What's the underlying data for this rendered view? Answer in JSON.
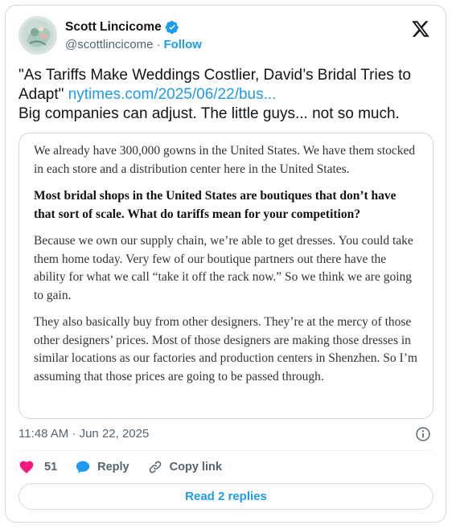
{
  "author": {
    "name": "Scott Lincicome",
    "handle": "@scottlincicome",
    "separator": "·",
    "follow_label": "Follow"
  },
  "tweet": {
    "text_line1_prefix": "\"As Tariffs Make Weddings Costlier, David’s Bridal Tries to Adapt\"",
    "link": "nytimes.com/2025/06/22/bus...",
    "text_line2": "Big companies can adjust. The little guys... not so much."
  },
  "quoted_image": {
    "paragraphs": [
      {
        "text": "We already have 300,000 gowns in the United States. We have them stocked in each store and a distribution center here in the United States.",
        "bold": false
      },
      {
        "text": "Most bridal shops in the United States are boutiques that don’t have that sort of scale. What do tariffs mean for your competition?",
        "bold": true
      },
      {
        "text": "Because we own our supply chain, we’re able to get dresses. You could take them home today. Very few of our boutique partners out there have the ability for what we call “take it off the rack now.” So we think we are going to gain.",
        "bold": false
      },
      {
        "text": "They also basically buy from other designers. They’re at the mercy of those other designers’ prices. Most of those designers are making those dresses in similar locations as our factories and production centers in Shenzhen. So I’m assuming that those prices are going to be passed through.",
        "bold": false
      }
    ]
  },
  "timestamp": "11:48 AM · Jun 22, 2025",
  "actions": {
    "like_count": "51",
    "reply_label": "Reply",
    "copy_link_label": "Copy link"
  },
  "replies_button_label": "Read 2 replies",
  "icons": {
    "verified": "verified-badge-icon",
    "x_logo": "x-logo-icon",
    "info": "info-icon",
    "like": "heart-icon",
    "reply": "speech-bubble-icon",
    "copy_link": "link-icon"
  },
  "colors": {
    "accent": "#1d9bf0",
    "like": "#f91880",
    "text": "#0f1419",
    "muted": "#536471",
    "border": "#cfd9de"
  }
}
